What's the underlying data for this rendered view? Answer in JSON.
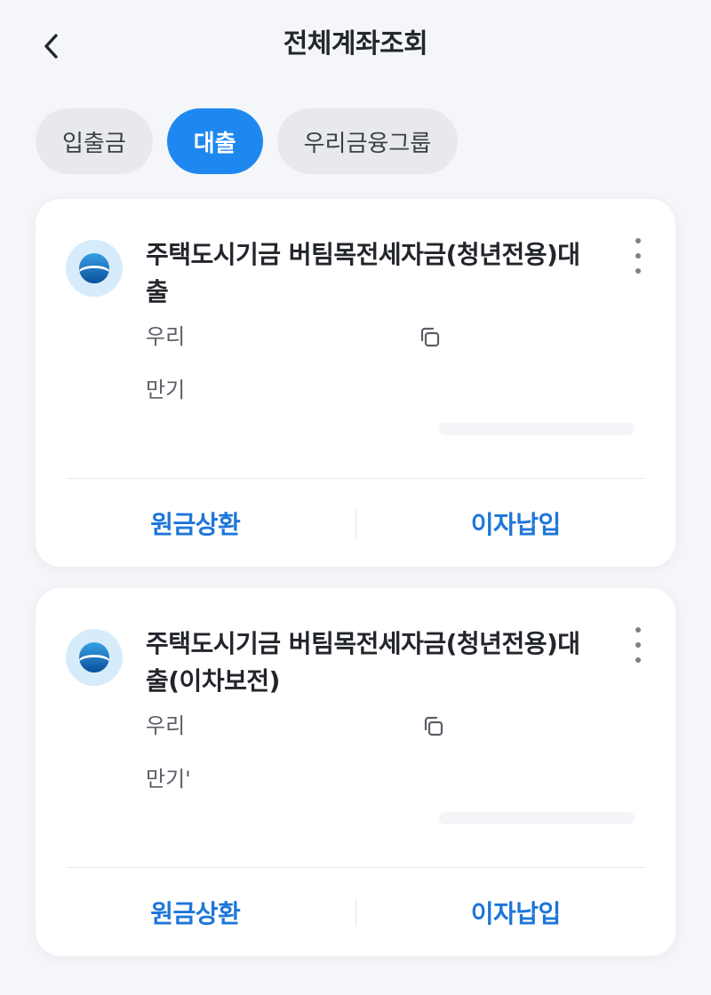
{
  "header": {
    "title": "전체계좌조회",
    "back_icon": "chevron-left-icon"
  },
  "tabs": [
    {
      "label": "입출금",
      "active": false
    },
    {
      "label": "대출",
      "active": true
    },
    {
      "label": "우리금융그룹",
      "active": false
    }
  ],
  "accounts": [
    {
      "product_name": "주택도시기금 버팀목전세자금(청년전용)대출",
      "bank": "우리",
      "maturity_label": "만기",
      "actions": {
        "repay_principal": "원금상환",
        "pay_interest": "이자납입"
      }
    },
    {
      "product_name": "주택도시기금 버팀목전세자금(청년전용)대출(이차보전)",
      "bank": "우리",
      "maturity_label": "만기'",
      "actions": {
        "repay_principal": "원금상환",
        "pay_interest": "이자납입"
      }
    }
  ],
  "colors": {
    "accent": "#1e88f0",
    "action_text": "#1e76d8",
    "background": "#f5f6f9",
    "card": "#ffffff",
    "tab_inactive": "#e7e9ee"
  }
}
